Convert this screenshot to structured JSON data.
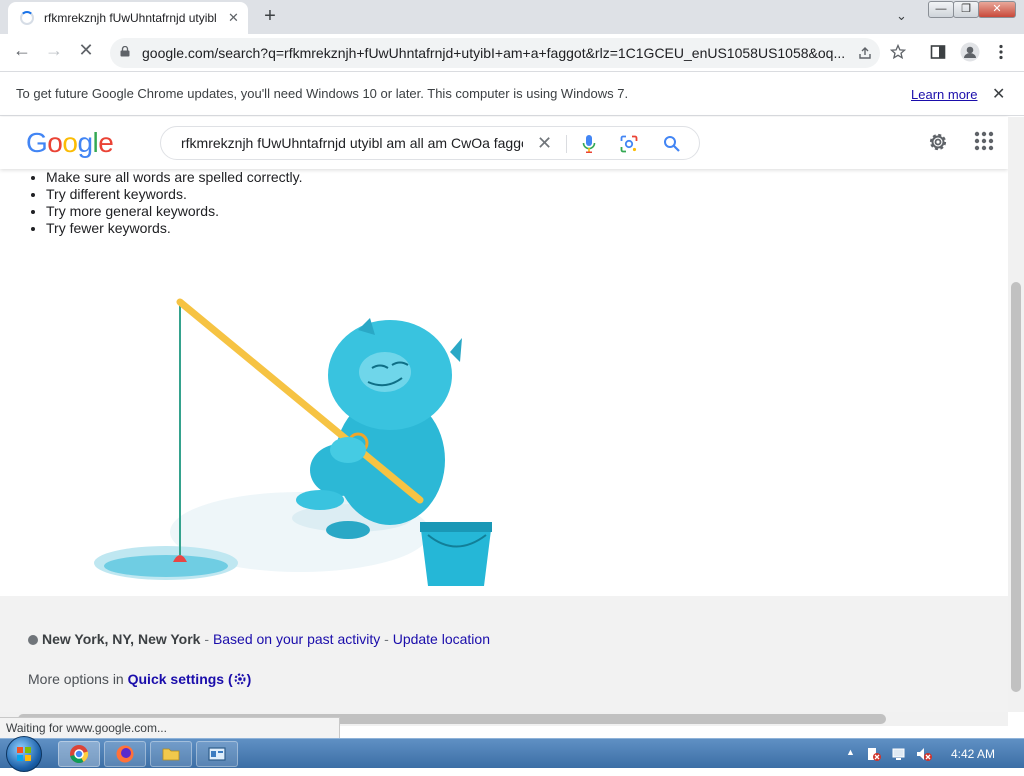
{
  "tab": {
    "title": "rfkmrekznjh fUwUhntafrnjd utyibl",
    "close": "✕",
    "new_tab": "+"
  },
  "window": {
    "minimize": "—",
    "restore": "❐",
    "close": "✕",
    "tab_search": "⌄"
  },
  "toolbar": {
    "url": "google.com/search?q=rfkmrekznjh+fUwUhntafrnjd+utyibI+am+a+faggot&rlz=1C1GCEU_enUS1058US1058&oq...",
    "back": "←",
    "forward": "→",
    "stop": "✕"
  },
  "infobar": {
    "message": "To get future Google Chrome updates, you'll need Windows 10 or later. This computer is using Windows 7.",
    "link": "Learn more",
    "close": "✕"
  },
  "google": {
    "logo": [
      "G",
      "o",
      "o",
      "g",
      "l",
      "e"
    ],
    "logo_colors": [
      "#4285f4",
      "#ea4335",
      "#fbbc05",
      "#4285f4",
      "#34a853",
      "#ea4335"
    ],
    "query": "rfkmrekznjh fUwUhntafrnjd utyibl am all am CwOa faggot",
    "clear": "✕"
  },
  "suggestions": [
    "Make sure all words are spelled correctly.",
    "Try different keywords.",
    "Try more general keywords.",
    "Try fewer keywords."
  ],
  "footer": {
    "location": "New York, NY, New York",
    "sep1": " - ",
    "past_activity": "Based on your past activity",
    "sep2": " - ",
    "update_location": "Update location",
    "more_options": "More options in ",
    "quick_settings": "Quick settings (",
    "quick_settings_close": ")"
  },
  "status_bar": "Waiting for www.google.com...",
  "taskbar": {
    "time": "4:42 AM",
    "tray_arrow": "▲"
  },
  "colors": {
    "accent": "#1a73e8",
    "link": "#1a0dab",
    "footer_bg": "#f2f2f2"
  }
}
